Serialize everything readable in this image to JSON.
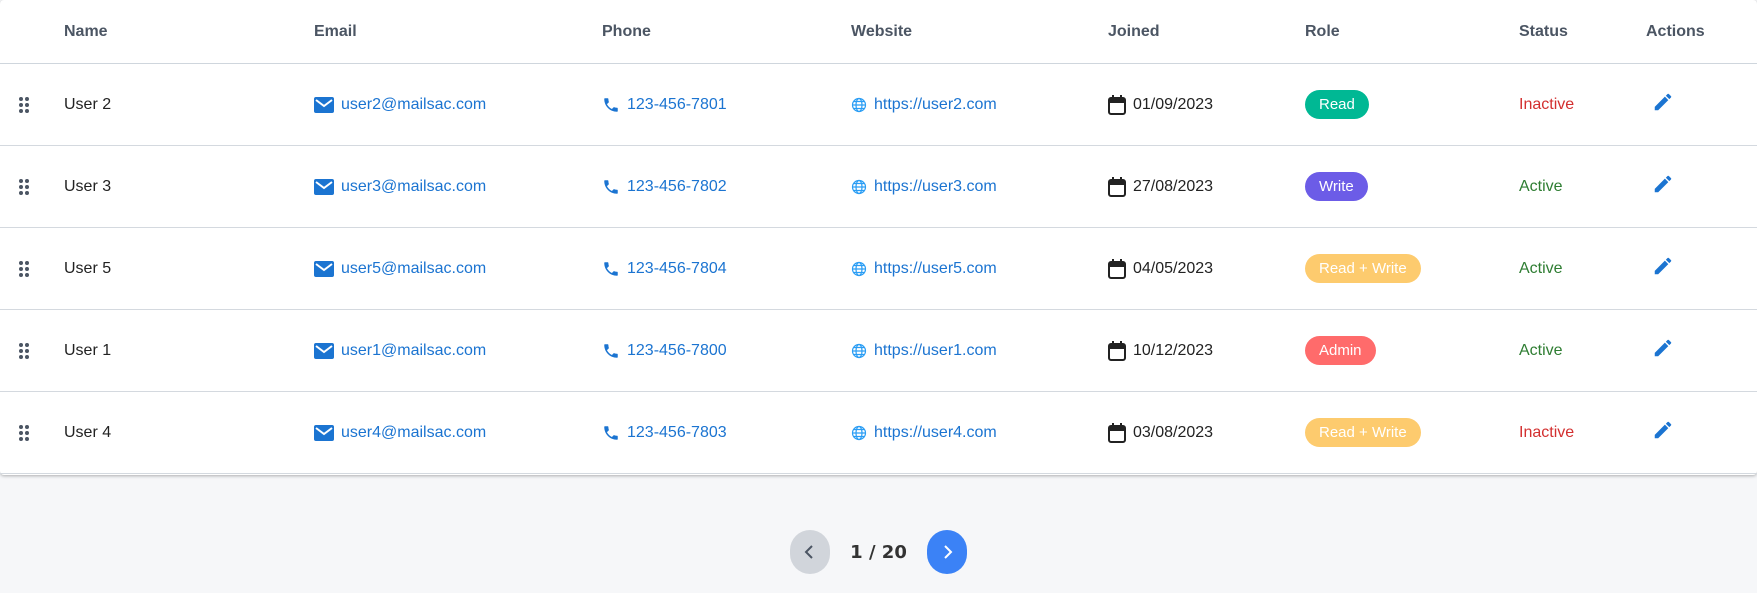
{
  "headers": {
    "name": "Name",
    "email": "Email",
    "phone": "Phone",
    "website": "Website",
    "joined": "Joined",
    "role": "Role",
    "status": "Status",
    "actions": "Actions"
  },
  "colors": {
    "Read": "#00b894",
    "Write": "#6c5ce7",
    "Read + Write": "#fdcb6e",
    "Admin": "#ff6b6b",
    "link": "#1b74d1"
  },
  "rows": [
    {
      "name": "User 2",
      "email": "user2@mailsac.com",
      "phone": "123-456-7801",
      "website": "https://user2.com",
      "joined": "01/09/2023",
      "role": "Read",
      "status": "Inactive"
    },
    {
      "name": "User 3",
      "email": "user3@mailsac.com",
      "phone": "123-456-7802",
      "website": "https://user3.com",
      "joined": "27/08/2023",
      "role": "Write",
      "status": "Active"
    },
    {
      "name": "User 5",
      "email": "user5@mailsac.com",
      "phone": "123-456-7804",
      "website": "https://user5.com",
      "joined": "04/05/2023",
      "role": "Read + Write",
      "status": "Active"
    },
    {
      "name": "User 1",
      "email": "user1@mailsac.com",
      "phone": "123-456-7800",
      "website": "https://user1.com",
      "joined": "10/12/2023",
      "role": "Admin",
      "status": "Active"
    },
    {
      "name": "User 4",
      "email": "user4@mailsac.com",
      "phone": "123-456-7803",
      "website": "https://user4.com",
      "joined": "03/08/2023",
      "role": "Read + Write",
      "status": "Inactive"
    }
  ],
  "pagination": {
    "label": "1 / 20"
  }
}
